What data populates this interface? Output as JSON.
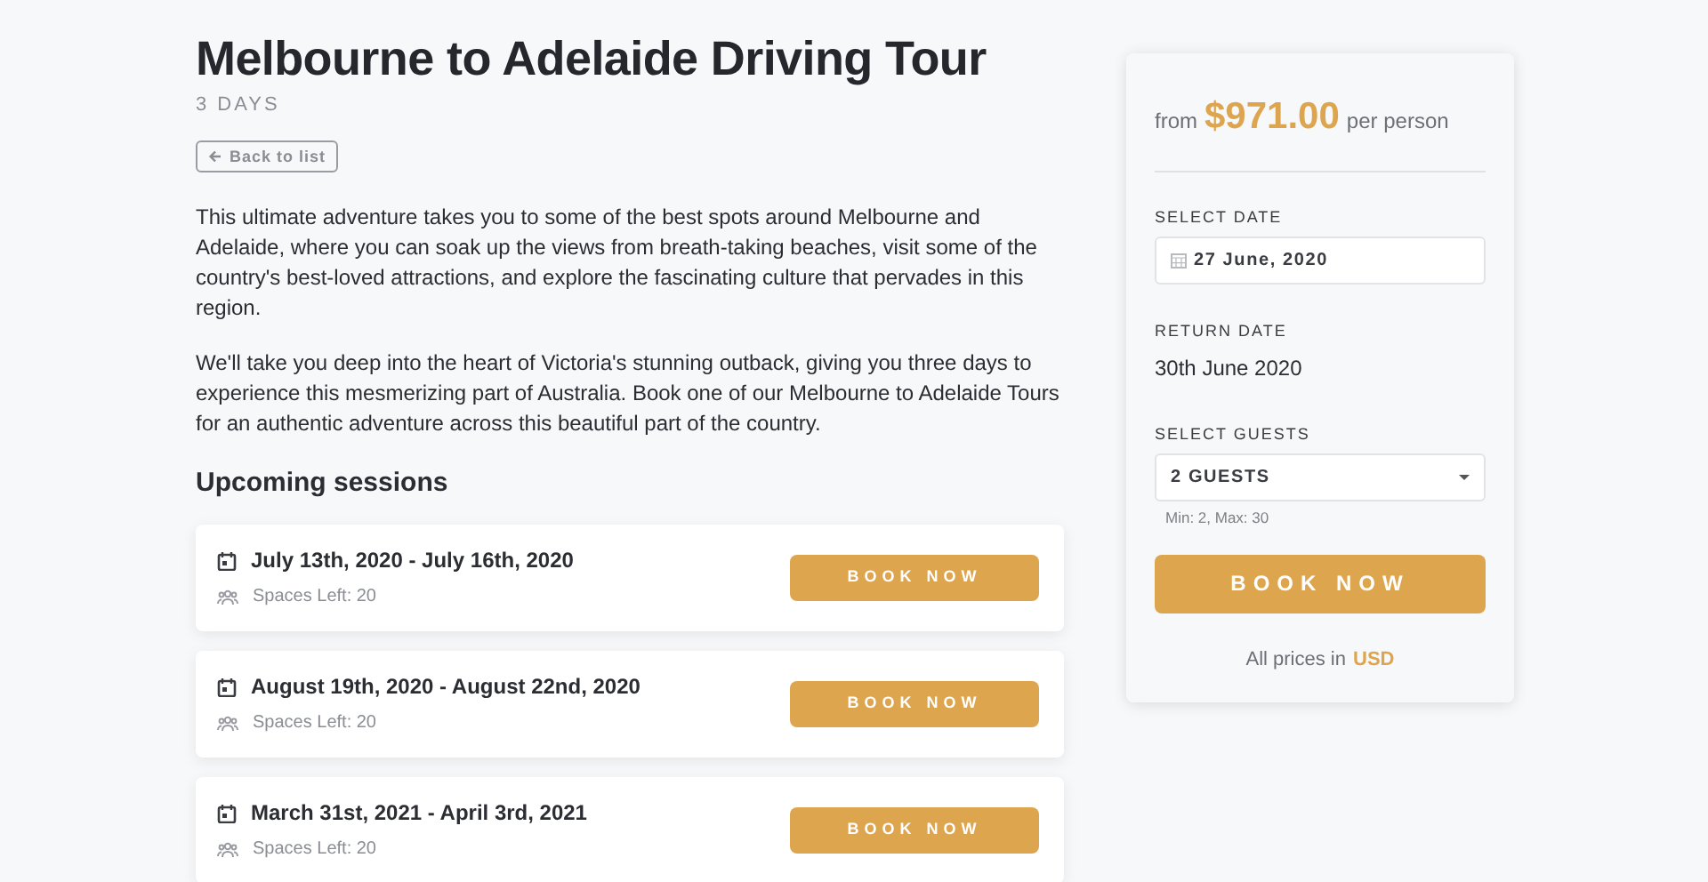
{
  "tour": {
    "title": "Melbourne to Adelaide Driving Tour",
    "duration": "3 DAYS",
    "back_link": "Back to list",
    "paragraphs": [
      "This ultimate adventure takes you to some of the best spots around Melbourne and Adelaide, where you can soak up the views from breath-taking beaches, visit some of the country's best-loved attractions, and explore the fascinating culture that pervades in this region.",
      "We'll take you deep into the heart of Victoria's stunning outback, giving you three days to experience this mesmerizing part of Australia. Book one of our Melbourne to Adelaide Tours for an authentic adventure across this beautiful part of the country."
    ]
  },
  "sessions": {
    "heading": "Upcoming sessions",
    "items": [
      {
        "dates": "July 13th, 2020 - July 16th, 2020",
        "spaces": "Spaces Left: 20",
        "button": "BOOK NOW"
      },
      {
        "dates": "August 19th, 2020 - August 22nd, 2020",
        "spaces": "Spaces Left: 20",
        "button": "BOOK NOW"
      },
      {
        "dates": "March 31st, 2021 - April 3rd, 2021",
        "spaces": "Spaces Left: 20",
        "button": "BOOK NOW"
      }
    ]
  },
  "booking": {
    "price_prefix": "from",
    "price": "$971.00",
    "price_suffix": "per person",
    "date_label": "SELECT DATE",
    "date_value": "27 June, 2020",
    "return_label": "RETURN DATE",
    "return_value": "30th June 2020",
    "guests_label": "SELECT GUESTS",
    "guests_value": "2 GUESTS",
    "guests_hint": "Min: 2, Max: 30",
    "button": "BOOK NOW",
    "currency_note": "All prices in",
    "currency": "USD"
  }
}
